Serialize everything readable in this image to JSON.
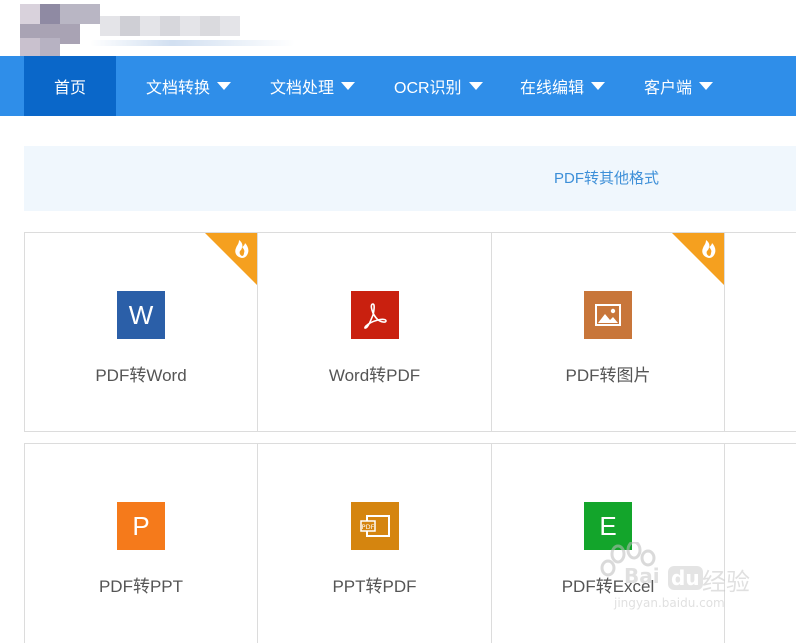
{
  "nav": {
    "items": [
      {
        "label": "首页",
        "active": true
      },
      {
        "label": "文档转换",
        "dropdown": true
      },
      {
        "label": "文档处理",
        "dropdown": true
      },
      {
        "label": "OCR识别",
        "dropdown": true
      },
      {
        "label": "在线编辑",
        "dropdown": true
      },
      {
        "label": "客户端",
        "dropdown": true
      }
    ]
  },
  "banner": {
    "title": "PDF转其他格式"
  },
  "cards": [
    {
      "label": "PDF转Word",
      "icon": "word-icon",
      "glyph": "W",
      "color": "#2b5fa8",
      "hot": true
    },
    {
      "label": "Word转PDF",
      "icon": "acrobat-icon",
      "glyph": "",
      "color": "#c9200f",
      "hot": false
    },
    {
      "label": "PDF转图片",
      "icon": "image-icon",
      "glyph": "",
      "color": "#c8763a",
      "hot": true
    },
    {
      "label": "PDF转PPT",
      "icon": "powerpoint-icon",
      "glyph": "P",
      "color": "#f57a1b",
      "hot": false
    },
    {
      "label": "PPT转PDF",
      "icon": "ppt-pdf-icon",
      "glyph": "PDF",
      "color": "#d5850f",
      "hot": false
    },
    {
      "label": "PDF转Excel",
      "icon": "excel-icon",
      "glyph": "E",
      "color": "#13a52b",
      "hot": false
    }
  ],
  "colors": {
    "nav": "#2f8ee9",
    "nav_active": "#0a67c9",
    "hot_badge": "#f5a01f"
  },
  "watermark": {
    "brand": "Bai",
    "brand2": "du",
    "cn": "经验",
    "url": "jingyan.baidu.com"
  }
}
